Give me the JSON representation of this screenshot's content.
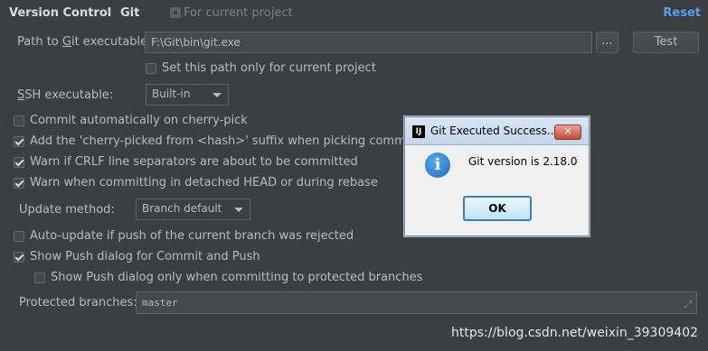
{
  "header": {
    "title": "Version Control",
    "separator": "›",
    "section": "Git",
    "scope_text": "For current project",
    "reset_label": "Reset"
  },
  "git_path": {
    "label_pre": "Path to ",
    "label_mnemonic": "G",
    "label_post": "it executable:",
    "value": "F:\\Git\\bin\\git.exe",
    "browse_label": "...",
    "test_label": "Test",
    "only_current_project_label": "Set this path only for current project",
    "only_current_project_checked": false
  },
  "ssh": {
    "label_mnemonic": "S",
    "label_post": "SH executable:",
    "selected": "Built-in"
  },
  "options": [
    {
      "label": "Commit automatically on cherry-pick",
      "checked": false
    },
    {
      "label": "Add the 'cherry-picked from <hash>' suffix when picking commits push",
      "checked": true
    },
    {
      "label": "Warn if CRLF line separators are about to be committed",
      "checked": true
    },
    {
      "label": "Warn when committing in detached HEAD or during rebase",
      "checked": true
    }
  ],
  "update_method": {
    "label": "Update method:",
    "selected": "Branch default"
  },
  "options2": [
    {
      "label": "Auto-update if push of the current branch was rejected",
      "checked": false
    },
    {
      "label": "Show Push dialog for Commit and Push",
      "checked": true
    },
    {
      "label": "Show Push dialog only when committing to protected branches",
      "checked": false
    }
  ],
  "protected": {
    "label": "Protected branches:",
    "value": "master"
  },
  "dialog": {
    "title": "Git Executed Success...",
    "close_label": "✕",
    "icon_glyph": "i",
    "app_icon_glyph": "IJ",
    "message": "Git version is 2.18.0",
    "ok_label": "OK"
  },
  "watermark": "https://blog.csdn.net/weixin_39309402"
}
